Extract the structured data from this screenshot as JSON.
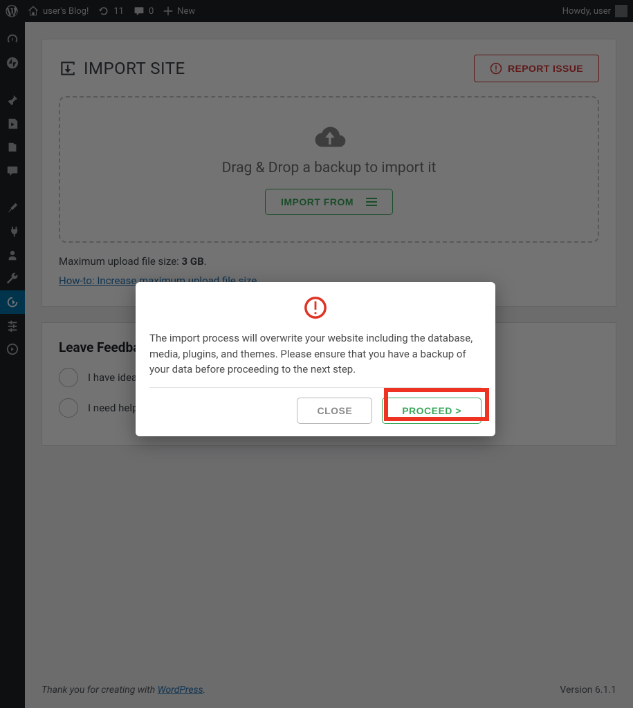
{
  "adminbar": {
    "site_title": "user's Blog!",
    "updates_count": "11",
    "comments_count": "0",
    "new_label": "New",
    "howdy": "Howdy, user"
  },
  "panel": {
    "title": "IMPORT SITE",
    "report_label": "REPORT ISSUE",
    "drop_text": "Drag & Drop a backup to import it",
    "import_from_label": "IMPORT FROM",
    "max_prefix": "Maximum upload file size: ",
    "max_size": "3 GB",
    "max_suffix": ".",
    "howto_text": "How-to: Increase maximum upload file size"
  },
  "feedback": {
    "title": "Leave Feedback",
    "option1": "I have ideas to improve this plugin",
    "option2": "I need help with this plugin"
  },
  "modal": {
    "message": "The import process will overwrite your website including the database, media, plugins, and themes. Please ensure that you have a backup of your data before proceeding to the next step.",
    "close_label": "CLOSE",
    "proceed_label": "PROCEED >"
  },
  "footer": {
    "thanks_prefix": "Thank you for creating with ",
    "wp": "WordPress",
    "thanks_suffix": ".",
    "version": "Version 6.1.1"
  }
}
